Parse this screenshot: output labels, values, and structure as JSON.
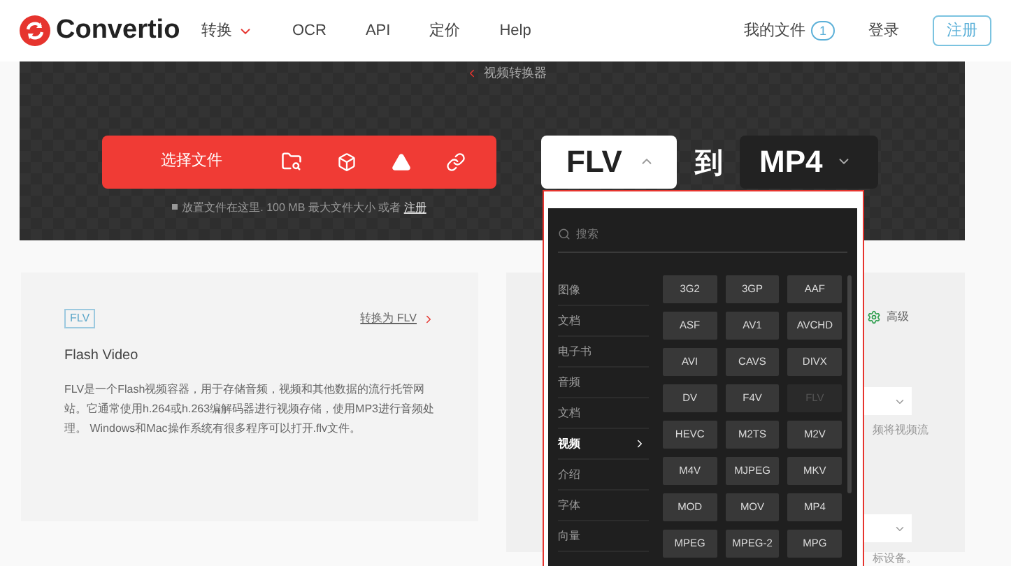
{
  "header": {
    "logo": "Convertio",
    "nav": [
      {
        "label": "转换",
        "dropdown": true
      },
      {
        "label": "OCR",
        "dropdown": false
      },
      {
        "label": "API",
        "dropdown": false
      },
      {
        "label": "定价",
        "dropdown": false
      },
      {
        "label": "Help",
        "dropdown": false
      }
    ],
    "my_files": "我的文件",
    "files_count": "1",
    "login": "登录",
    "signup": "注册"
  },
  "hero": {
    "breadcrumb": "视频转换器",
    "choose_file": "选择文件",
    "drop_hint": "放置文件在这里. 100 MB 最大文件大小 或者",
    "drop_link": "注册",
    "from_format": "FLV",
    "to_label": "到",
    "to_format": "MP4"
  },
  "info_card": {
    "tag": "FLV",
    "convert_link": "转换为 FLV",
    "title": "Flash Video",
    "description": "FLV是一个Flash视频容器，用于存储音频，视频和其他数据的流行托管网站。它通常使用h.264或h.263编解码器进行视频存储，使用MP3进行音频处理。 Windows和Mac操作系统有很多程序可以打开.flv文件。"
  },
  "settings_card": {
    "advanced": "高级",
    "fragment_1": "频将视频流",
    "fragment_2": "标设备。"
  },
  "format_menu": {
    "search_placeholder": "搜索",
    "categories": [
      {
        "label": "图像",
        "selected": false
      },
      {
        "label": "文档",
        "selected": false
      },
      {
        "label": "电子书",
        "selected": false
      },
      {
        "label": "音频",
        "selected": false
      },
      {
        "label": "文档",
        "selected": false
      },
      {
        "label": "视频",
        "selected": true
      },
      {
        "label": "介绍",
        "selected": false
      },
      {
        "label": "字体",
        "selected": false
      },
      {
        "label": "向量",
        "selected": false
      }
    ],
    "formats": [
      {
        "label": "3G2",
        "disabled": false
      },
      {
        "label": "3GP",
        "disabled": false
      },
      {
        "label": "AAF",
        "disabled": false
      },
      {
        "label": "ASF",
        "disabled": false
      },
      {
        "label": "AV1",
        "disabled": false
      },
      {
        "label": "AVCHD",
        "disabled": false
      },
      {
        "label": "AVI",
        "disabled": false
      },
      {
        "label": "CAVS",
        "disabled": false
      },
      {
        "label": "DIVX",
        "disabled": false
      },
      {
        "label": "DV",
        "disabled": false
      },
      {
        "label": "F4V",
        "disabled": false
      },
      {
        "label": "FLV",
        "disabled": true
      },
      {
        "label": "HEVC",
        "disabled": false
      },
      {
        "label": "M2TS",
        "disabled": false
      },
      {
        "label": "M2V",
        "disabled": false
      },
      {
        "label": "M4V",
        "disabled": false
      },
      {
        "label": "MJPEG",
        "disabled": false
      },
      {
        "label": "MKV",
        "disabled": false
      },
      {
        "label": "MOD",
        "disabled": false
      },
      {
        "label": "MOV",
        "disabled": false
      },
      {
        "label": "MP4",
        "disabled": false
      },
      {
        "label": "MPEG",
        "disabled": false
      },
      {
        "label": "MPEG-2",
        "disabled": false
      },
      {
        "label": "MPG",
        "disabled": false
      }
    ]
  }
}
